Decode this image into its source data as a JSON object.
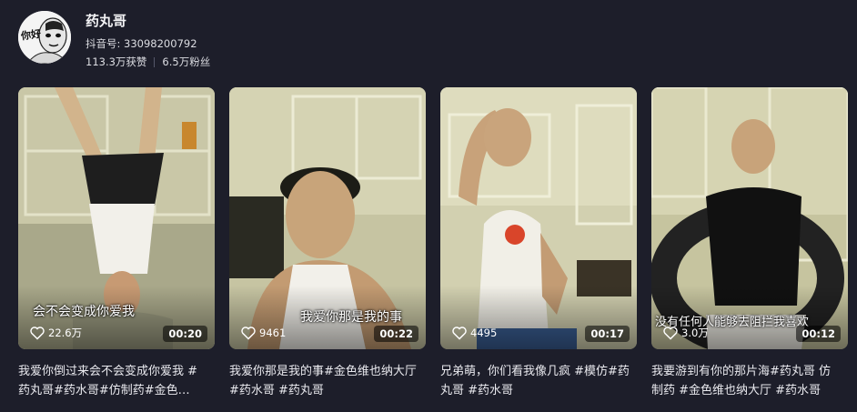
{
  "profile": {
    "avatar_text": "你好",
    "name": "药丸哥",
    "douyin_id": "抖音号: 33098200792",
    "likes": "113.3万获赞",
    "followers": "6.5万粉丝"
  },
  "videos": [
    {
      "overlay_text": "会不会变成你爱我",
      "likes": "22.6万",
      "duration": "00:20",
      "caption": "我爱你倒过来会不会变成你爱我 #药丸哥#药水哥#仿制药#金色…"
    },
    {
      "overlay_text": "我爱你那是我的事",
      "likes": "9461",
      "duration": "00:22",
      "caption": "我爱你那是我的事#金色维也纳大厅 #药水哥 #药丸哥"
    },
    {
      "overlay_text": "",
      "likes": "4495",
      "duration": "00:17",
      "caption": "兄弟萌，你们看我像几疯 #模仿#药丸哥 #药水哥"
    },
    {
      "overlay_text": "没有任何人能够去阻拦我喜欢",
      "likes": "3.0万",
      "duration": "00:12",
      "caption": "我要游到有你的那片海#药丸哥 仿制药 #金色维也纳大厅 #药水哥"
    }
  ],
  "icons": {
    "like": "heart-outline-icon"
  },
  "colors": {
    "background": "#1d1e2a",
    "text": "#ffffff",
    "muted": "#dcdde2"
  }
}
